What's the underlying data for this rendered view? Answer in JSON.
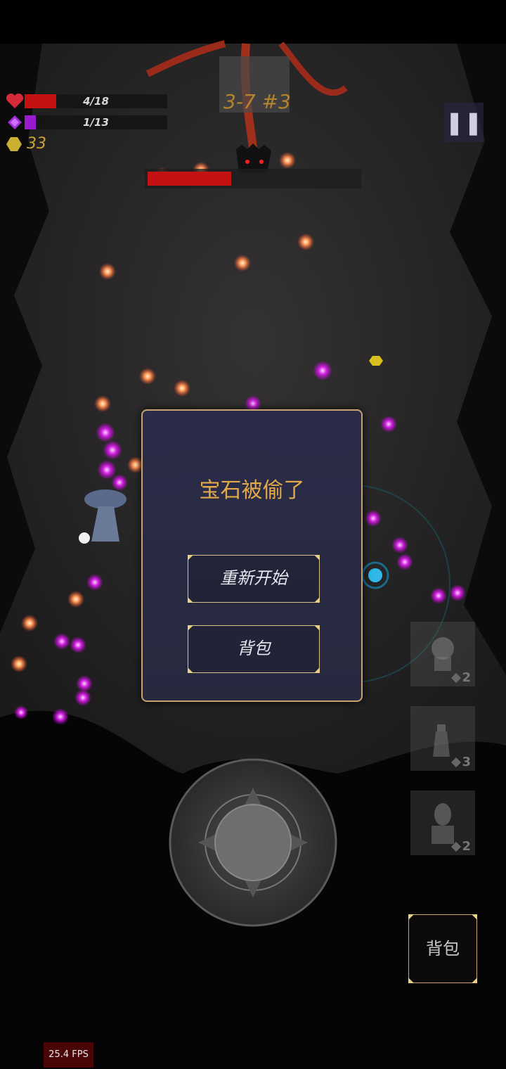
{
  "hud": {
    "health": {
      "current": 4,
      "max": 18,
      "text": "4/18",
      "color": "#c41212",
      "icon": "heart-icon"
    },
    "mana": {
      "current": 1,
      "max": 13,
      "text": "1/13",
      "color": "#9a1ad0",
      "icon": "diamond-icon"
    },
    "gold": {
      "count": "33",
      "icon": "coin-icon"
    },
    "stage": "3-7 #3",
    "pause_icon": "pause-icon"
  },
  "boss": {
    "health_fraction": 0.4,
    "color": "#c41212"
  },
  "dialog": {
    "title": "宝石被偷了",
    "restart_label": "重新开始",
    "bag_label": "背包"
  },
  "skills": [
    {
      "count": "2",
      "icon": "creature-skill-icon"
    },
    {
      "count": "3",
      "icon": "chess-piece-skill-icon"
    },
    {
      "count": "2",
      "icon": "statue-skill-icon"
    }
  ],
  "bag_button": "背包",
  "fps": "25.4 FPS",
  "colors": {
    "gold": "#c9a23a",
    "dialog_border": "#c9a070",
    "dialog_title": "#e2a84a"
  }
}
